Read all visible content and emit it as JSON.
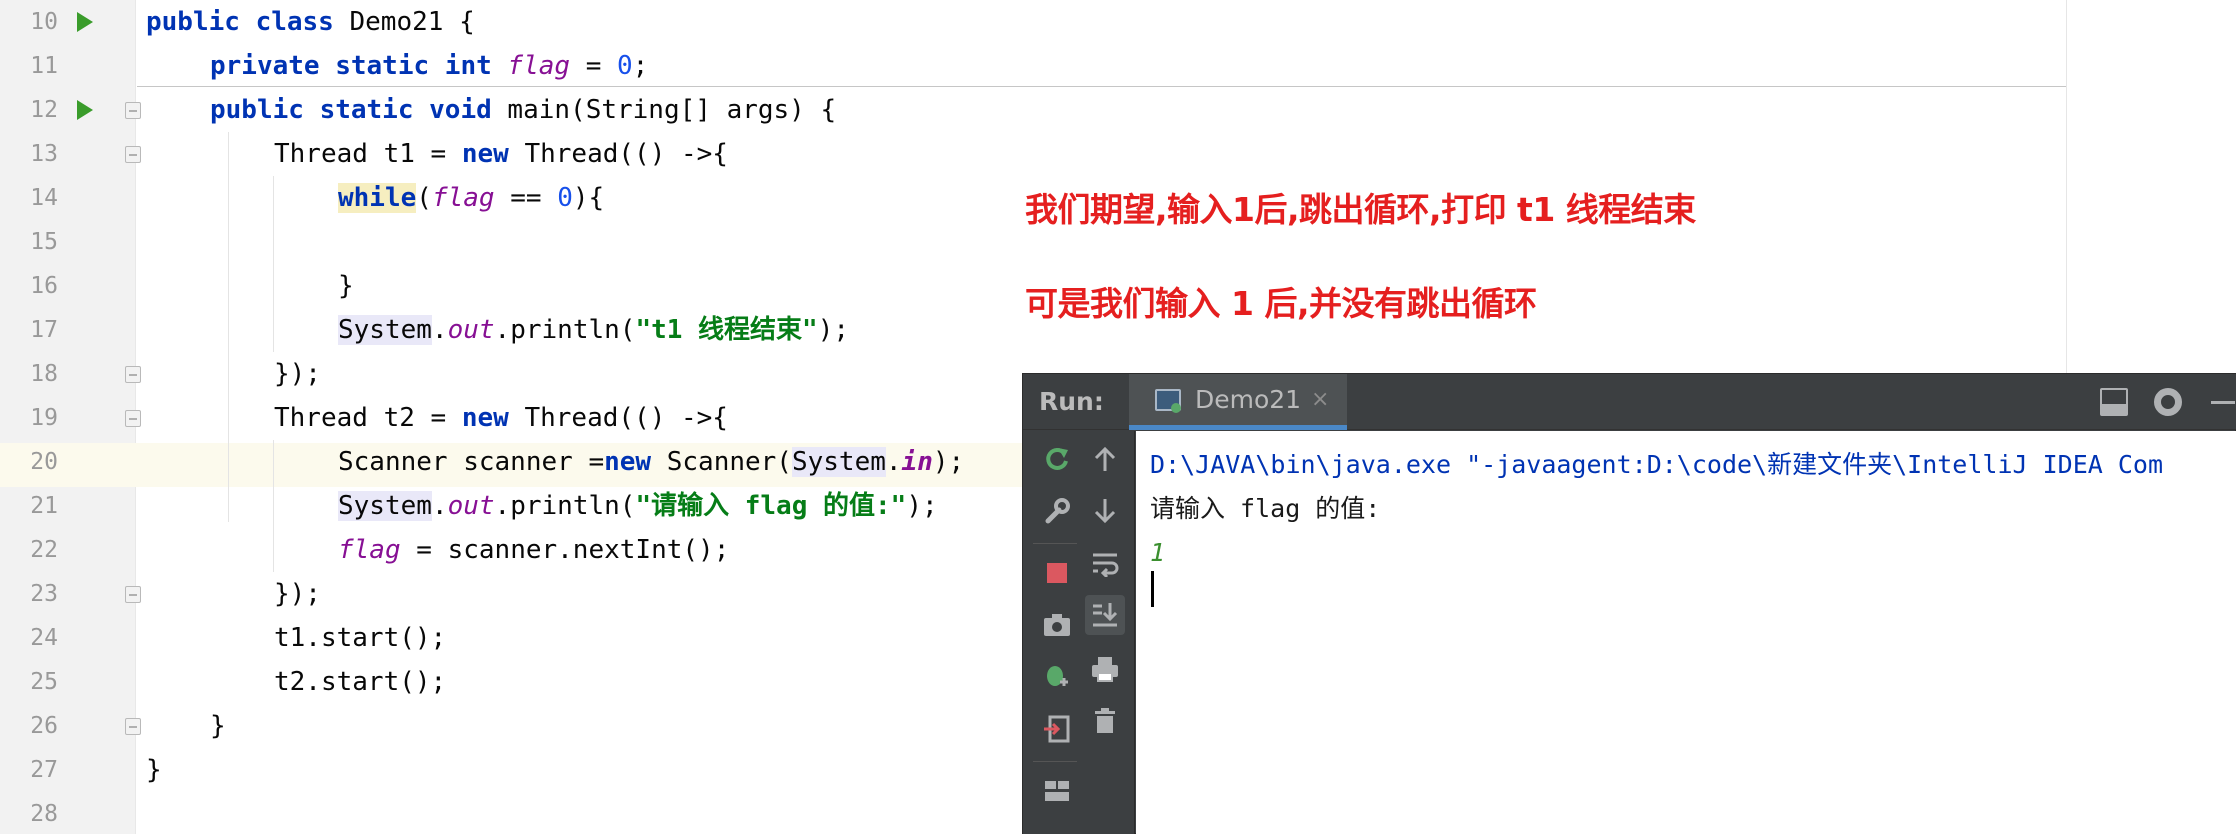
{
  "editor": {
    "lines": [
      {
        "n": "10"
      },
      {
        "n": "11"
      },
      {
        "n": "12"
      },
      {
        "n": "13"
      },
      {
        "n": "14"
      },
      {
        "n": "15"
      },
      {
        "n": "16"
      },
      {
        "n": "17"
      },
      {
        "n": "18"
      },
      {
        "n": "19"
      },
      {
        "n": "20"
      },
      {
        "n": "21"
      },
      {
        "n": "22"
      },
      {
        "n": "23"
      },
      {
        "n": "24"
      },
      {
        "n": "25"
      },
      {
        "n": "26"
      },
      {
        "n": "27"
      },
      {
        "n": "28"
      }
    ],
    "code": {
      "l10_kw": "public class ",
      "l10_rest": "Demo21 {",
      "l11_kw": "private static int ",
      "l11_fld": "flag",
      "l11_eq": " = ",
      "l11_num": "0",
      "l11_end": ";",
      "l12_kw": "public static void ",
      "l12_rest": "main(String[] args) {",
      "l13_a": "Thread t1 = ",
      "l13_kw": "new ",
      "l13_b": "Thread(() ->{",
      "l14_kw": "while",
      "l14_a": "(",
      "l14_fld": "flag",
      "l14_b": " == ",
      "l14_num": "0",
      "l14_c": "){",
      "l16": "}",
      "l17_sys": "System",
      "l17_dot": ".",
      "l17_out": "out",
      "l17_a": ".println(",
      "l17_str": "\"t1 线程结束\"",
      "l17_end": ");",
      "l18": "});",
      "l19_a": "Thread t2 = ",
      "l19_kw": "new ",
      "l19_b": "Thread(() ->{",
      "l20_a": "Scanner scanner =",
      "l20_kw": "new ",
      "l20_b": "Scanner(",
      "l20_sys": "System",
      "l20_dot": ".",
      "l20_in": "in",
      "l20_end": ");",
      "l21_sys": "System",
      "l21_dot": ".",
      "l21_out": "out",
      "l21_a": ".println(",
      "l21_str": "\"请输入 flag 的值:\"",
      "l21_end": ");",
      "l22_fld": "flag",
      "l22_rest": " = scanner.nextInt();",
      "l23": "});",
      "l24": "t1.start();",
      "l25": "t2.start();",
      "l26": "}",
      "l27": "}"
    }
  },
  "annotations": {
    "expect": "我们期望,输入1后,跳出循环,打印 t1 线程结束",
    "actual": "可是我们输入 1 后,并没有跳出循环"
  },
  "run_window": {
    "label": "Run:",
    "tab": "Demo21",
    "tab_close": "×",
    "console": {
      "command": "D:\\JAVA\\bin\\java.exe \"-javaagent:D:\\code\\新建文件夹\\IntelliJ IDEA Com",
      "prompt": "请输入 flag 的值:",
      "input": "1"
    },
    "toolbar_icons": [
      "rerun-icon",
      "wrench-icon",
      "stop-icon",
      "camera-icon",
      "debug-icon",
      "exit-icon",
      "layout-icon",
      "up-arrow-icon",
      "down-arrow-icon",
      "soft-wrap-icon",
      "scroll-to-end-icon",
      "print-icon",
      "trash-icon"
    ]
  },
  "colors": {
    "keyword": "#0033b3",
    "field": "#871094",
    "string": "#067d17",
    "number": "#1750eb",
    "annotation": "#e51f1f",
    "run_icon": "#3a9c2b"
  }
}
